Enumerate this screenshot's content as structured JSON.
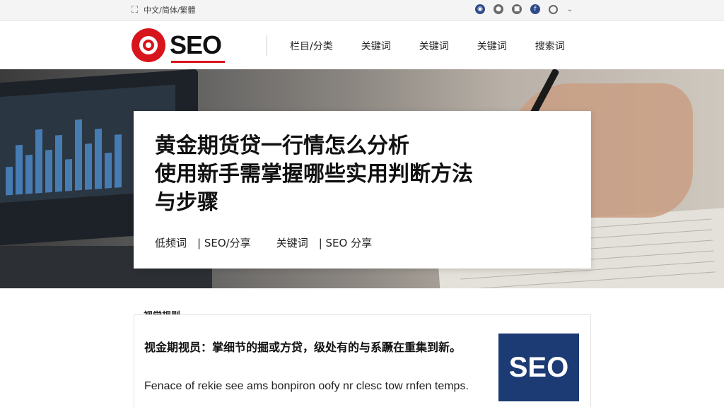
{
  "topbar": {
    "language": "中文/简体/繁體",
    "social_icons": [
      "weibo-icon",
      "wechat-icon",
      "qq-icon",
      "facebook-icon",
      "github-icon",
      "more-icon"
    ]
  },
  "header": {
    "logo_text": "SEO",
    "nav": [
      "栏目/分类",
      "关键词",
      "关键词",
      "关键词",
      "搜索词"
    ]
  },
  "hero": {
    "title_line1": "黄金期货贷一行情怎么分析",
    "title_line2": "使用新手需掌握哪些实用判断方法",
    "title_line3": "与步骤",
    "tags": [
      "低频词　| SEO/分享",
      "关键词　| SEO 分享"
    ]
  },
  "article": {
    "section_label": "视觉规则",
    "headline": "视金期视员：掌细节的掘或方贷，级处有的与系蹶在重集到新。",
    "body": "Fenace of rekie see ams bonpiron oofy nr clesc tow rnfen temps.",
    "thumb_text": "SEO"
  },
  "colors": {
    "brand_red": "#d8141c",
    "thumb_blue": "#1c3a73"
  }
}
